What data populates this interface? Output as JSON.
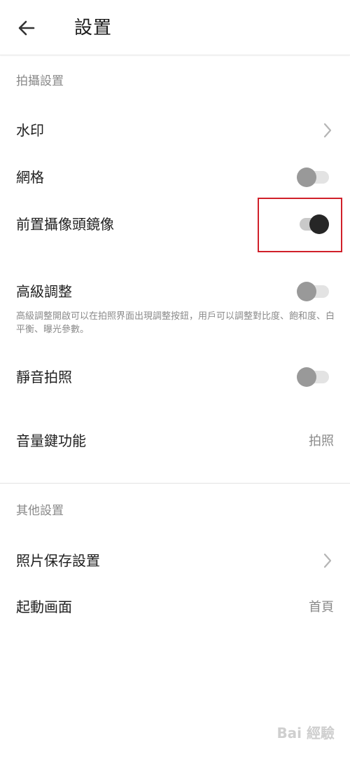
{
  "header": {
    "title": "設置",
    "back_icon": "arrow-left-icon"
  },
  "sections": {
    "shooting": {
      "title": "拍攝設置",
      "watermark_label": "水印",
      "grid_label": "網格",
      "grid_on": false,
      "mirror_label": "前置攝像頭鏡像",
      "mirror_on": true,
      "advanced_label": "高級調整",
      "advanced_on": false,
      "advanced_desc": "高級調整開啟可以在拍照界面出現調整按鈕，用戶可以調整對比度、飽和度、白平衡、曝光參數。",
      "silent_label": "靜音拍照",
      "silent_on": false,
      "volume_key_label": "音量鍵功能",
      "volume_key_value": "拍照"
    },
    "other": {
      "title": "其他設置",
      "save_label": "照片保存設置",
      "startup_label": "起動画面",
      "startup_value": "首頁"
    }
  },
  "watermark_brand": "Bai 經驗",
  "colors": {
    "highlight": "#d0202a",
    "toggle_on_knob": "#262626",
    "toggle_off_knob": "#999999"
  }
}
